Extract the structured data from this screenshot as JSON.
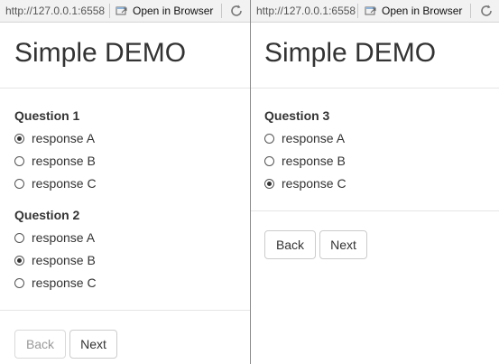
{
  "left_window": {
    "toolbar": {
      "url": "http://127.0.0.1:6558",
      "open_browser_label": "Open in Browser"
    },
    "page": {
      "title": "Simple DEMO",
      "questions": [
        {
          "label": "Question 1",
          "options": [
            {
              "label": "response A",
              "selected": true
            },
            {
              "label": "response B",
              "selected": false
            },
            {
              "label": "response C",
              "selected": false
            }
          ]
        },
        {
          "label": "Question 2",
          "options": [
            {
              "label": "response A",
              "selected": false
            },
            {
              "label": "response B",
              "selected": true
            },
            {
              "label": "response C",
              "selected": false
            }
          ]
        }
      ],
      "buttons": {
        "back_label": "Back",
        "back_disabled": true,
        "next_label": "Next"
      }
    }
  },
  "right_window": {
    "toolbar": {
      "url": "http://127.0.0.1:6558",
      "open_browser_label": "Open in Browser"
    },
    "page": {
      "title": "Simple DEMO",
      "questions": [
        {
          "label": "Question 3",
          "options": [
            {
              "label": "response A",
              "selected": false
            },
            {
              "label": "response B",
              "selected": false
            },
            {
              "label": "response C",
              "selected": true
            }
          ]
        }
      ],
      "buttons": {
        "back_label": "Back",
        "back_disabled": false,
        "next_label": "Next"
      }
    }
  },
  "icons": {
    "open_browser": "open-in-browser-icon",
    "refresh": "refresh-icon"
  },
  "colors": {
    "text": "#333333",
    "border": "#cccccc",
    "disabled_text": "#9a9a9a"
  }
}
